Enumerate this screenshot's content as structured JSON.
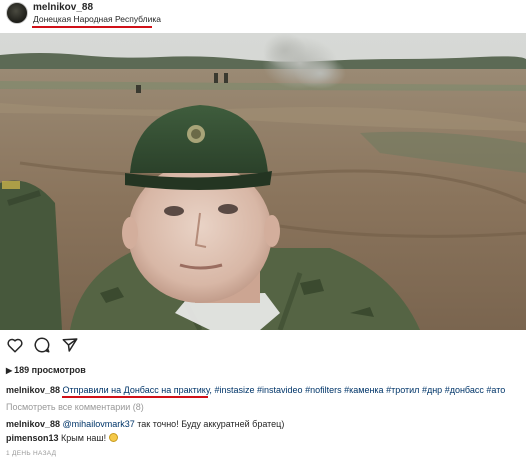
{
  "post": {
    "username": "melnikov_88",
    "location": "Донецкая Народная Республика",
    "views": "189 просмотров",
    "caption": {
      "user": "melnikov_88",
      "highlighted": "Отправили на Донбасс на практику,",
      "hashtags": [
        "#instasize",
        "#instavideo",
        "#nofilters",
        "#каменка",
        "#тротил",
        "#днр",
        "#донбасс",
        "#ато"
      ]
    },
    "view_all_comments": "Посмотреть все комментарии (8)",
    "comments": [
      {
        "user": "melnikov_88",
        "mention": "@mihailovmark37",
        "text": "так точно! Буду аккуратней братец)"
      },
      {
        "user": "pimenson13",
        "text": "Крым наш!"
      }
    ],
    "timestamp": "1 ДЕНЬ НАЗАД"
  },
  "icons": {
    "avatar": "avatar",
    "like": "heart-icon",
    "comment": "comment-icon",
    "share": "share-icon",
    "views": "video-views-icon"
  },
  "colors": {
    "annotation_underline": "#d01018",
    "link": "#003569",
    "muted": "#999999"
  }
}
